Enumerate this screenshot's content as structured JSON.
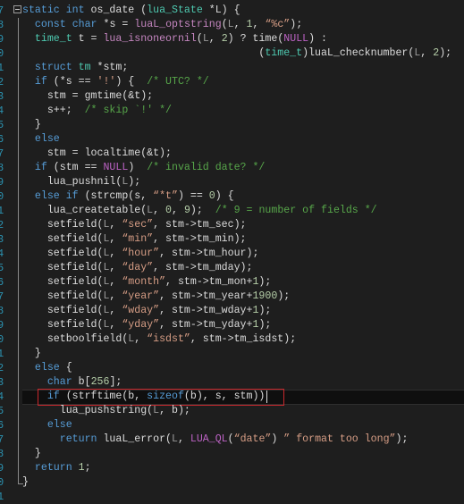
{
  "editor": {
    "colors": {
      "background": "#1e1e1e",
      "keyword": "#569cd6",
      "type": "#4ec9b0",
      "string": "#d69d85",
      "comment": "#57a64a",
      "highlight_box": "#c8282d",
      "line_number": "#2b91af"
    },
    "line_numbers": [
      "7",
      "8",
      "9",
      "0",
      "1",
      "2",
      "3",
      "4",
      "5",
      "6",
      "7",
      "8",
      "9",
      "0",
      "1",
      "2",
      "3",
      "4",
      "5",
      "6",
      "7",
      "8",
      "9",
      "0",
      "1",
      "2",
      "3",
      "4",
      "5",
      "6",
      "7",
      "8",
      "9",
      "0",
      "1"
    ],
    "current_line_index": 28,
    "lines": [
      [
        [
          "kw",
          "static"
        ],
        [
          "pl",
          " "
        ],
        [
          "kw",
          "int"
        ],
        [
          "pl",
          " os_date ("
        ],
        [
          "ty",
          "lua_State"
        ],
        [
          "pl",
          " *L) {"
        ]
      ],
      [
        [
          "pl",
          "  "
        ],
        [
          "kw",
          "const"
        ],
        [
          "pl",
          " "
        ],
        [
          "kw",
          "char"
        ],
        [
          "pl",
          " *s = "
        ],
        [
          "fn",
          "luaL_optstring"
        ],
        [
          "pl",
          "("
        ],
        [
          "id",
          "L"
        ],
        [
          "pl",
          ", "
        ],
        [
          "nu",
          "1"
        ],
        [
          "pl",
          ", "
        ],
        [
          "st",
          "“%c”"
        ],
        [
          "pl",
          ");"
        ]
      ],
      [
        [
          "pl",
          "  "
        ],
        [
          "ty",
          "time_t"
        ],
        [
          "pl",
          " t = "
        ],
        [
          "fn",
          "lua_isnoneornil"
        ],
        [
          "pl",
          "("
        ],
        [
          "id",
          "L"
        ],
        [
          "pl",
          ", "
        ],
        [
          "nu",
          "2"
        ],
        [
          "pl",
          ") ? time("
        ],
        [
          "mc",
          "NULL"
        ],
        [
          "pl",
          ") :"
        ]
      ],
      [
        [
          "pl",
          "                                      ("
        ],
        [
          "ty",
          "time_t"
        ],
        [
          "pl",
          ")luaL_checknumber("
        ],
        [
          "id",
          "L"
        ],
        [
          "pl",
          ", "
        ],
        [
          "nu",
          "2"
        ],
        [
          "pl",
          ");"
        ]
      ],
      [
        [
          "pl",
          "  "
        ],
        [
          "kw",
          "struct"
        ],
        [
          "pl",
          " "
        ],
        [
          "ty",
          "tm"
        ],
        [
          "pl",
          " *stm;"
        ]
      ],
      [
        [
          "pl",
          "  "
        ],
        [
          "kw",
          "if"
        ],
        [
          "pl",
          " (*s == "
        ],
        [
          "st",
          "'!'"
        ],
        [
          "pl",
          ") {  "
        ],
        [
          "cm",
          "/* UTC? */"
        ]
      ],
      [
        [
          "pl",
          "    stm = gmtime(&t);"
        ]
      ],
      [
        [
          "pl",
          "    s++;  "
        ],
        [
          "cm",
          "/* skip `!' */"
        ]
      ],
      [
        [
          "pl",
          "  }"
        ]
      ],
      [
        [
          "pl",
          "  "
        ],
        [
          "kw",
          "else"
        ]
      ],
      [
        [
          "pl",
          "    stm = localtime(&t);"
        ]
      ],
      [
        [
          "pl",
          "  "
        ],
        [
          "kw",
          "if"
        ],
        [
          "pl",
          " (stm == "
        ],
        [
          "mc",
          "NULL"
        ],
        [
          "pl",
          ")  "
        ],
        [
          "cm",
          "/* invalid date? */"
        ]
      ],
      [
        [
          "pl",
          "    lua_pushnil("
        ],
        [
          "id",
          "L"
        ],
        [
          "pl",
          ");"
        ]
      ],
      [
        [
          "pl",
          "  "
        ],
        [
          "kw",
          "else if"
        ],
        [
          "pl",
          " (strcmp(s, "
        ],
        [
          "st",
          "“*t”"
        ],
        [
          "pl",
          ") == "
        ],
        [
          "nu",
          "0"
        ],
        [
          "pl",
          ") {"
        ]
      ],
      [
        [
          "pl",
          "    lua_createtable("
        ],
        [
          "id",
          "L"
        ],
        [
          "pl",
          ", "
        ],
        [
          "nu",
          "0"
        ],
        [
          "pl",
          ", "
        ],
        [
          "nu",
          "9"
        ],
        [
          "pl",
          ");  "
        ],
        [
          "cm",
          "/* 9 = number of fields */"
        ]
      ],
      [
        [
          "pl",
          "    setfield("
        ],
        [
          "id",
          "L"
        ],
        [
          "pl",
          ", "
        ],
        [
          "st",
          "“sec”"
        ],
        [
          "pl",
          ", stm->tm_sec);"
        ]
      ],
      [
        [
          "pl",
          "    setfield("
        ],
        [
          "id",
          "L"
        ],
        [
          "pl",
          ", "
        ],
        [
          "st",
          "“min”"
        ],
        [
          "pl",
          ", stm->tm_min);"
        ]
      ],
      [
        [
          "pl",
          "    setfield("
        ],
        [
          "id",
          "L"
        ],
        [
          "pl",
          ", "
        ],
        [
          "st",
          "“hour”"
        ],
        [
          "pl",
          ", stm->tm_hour);"
        ]
      ],
      [
        [
          "pl",
          "    setfield("
        ],
        [
          "id",
          "L"
        ],
        [
          "pl",
          ", "
        ],
        [
          "st",
          "“day”"
        ],
        [
          "pl",
          ", stm->tm_mday);"
        ]
      ],
      [
        [
          "pl",
          "    setfield("
        ],
        [
          "id",
          "L"
        ],
        [
          "pl",
          ", "
        ],
        [
          "st",
          "“month”"
        ],
        [
          "pl",
          ", stm->tm_mon+"
        ],
        [
          "nu",
          "1"
        ],
        [
          "pl",
          ");"
        ]
      ],
      [
        [
          "pl",
          "    setfield("
        ],
        [
          "id",
          "L"
        ],
        [
          "pl",
          ", "
        ],
        [
          "st",
          "“year”"
        ],
        [
          "pl",
          ", stm->tm_year+"
        ],
        [
          "nu",
          "1900"
        ],
        [
          "pl",
          ");"
        ]
      ],
      [
        [
          "pl",
          "    setfield("
        ],
        [
          "id",
          "L"
        ],
        [
          "pl",
          ", "
        ],
        [
          "st",
          "“wday”"
        ],
        [
          "pl",
          ", stm->tm_wday+"
        ],
        [
          "nu",
          "1"
        ],
        [
          "pl",
          ");"
        ]
      ],
      [
        [
          "pl",
          "    setfield("
        ],
        [
          "id",
          "L"
        ],
        [
          "pl",
          ", "
        ],
        [
          "st",
          "“yday”"
        ],
        [
          "pl",
          ", stm->tm_yday+"
        ],
        [
          "nu",
          "1"
        ],
        [
          "pl",
          ");"
        ]
      ],
      [
        [
          "pl",
          "    setboolfield("
        ],
        [
          "id",
          "L"
        ],
        [
          "pl",
          ", "
        ],
        [
          "st",
          "“isdst”"
        ],
        [
          "pl",
          ", stm->tm_isdst);"
        ]
      ],
      [
        [
          "pl",
          "  }"
        ]
      ],
      [
        [
          "pl",
          "  "
        ],
        [
          "kw",
          "else"
        ],
        [
          "pl",
          " {"
        ]
      ],
      [
        [
          "pl",
          "    "
        ],
        [
          "kw",
          "char"
        ],
        [
          "pl",
          " b["
        ],
        [
          "nu",
          "256"
        ],
        [
          "pl",
          "];"
        ]
      ],
      [
        [
          "pl",
          "    "
        ],
        [
          "kw",
          "if"
        ],
        [
          "pl",
          " (strftime(b, "
        ],
        [
          "kw",
          "sizeof"
        ],
        [
          "pl",
          "(b), s, stm))"
        ]
      ],
      [
        [
          "pl",
          "      lua_pushstring("
        ],
        [
          "id",
          "L"
        ],
        [
          "pl",
          ", b);"
        ]
      ],
      [
        [
          "pl",
          "    "
        ],
        [
          "kw",
          "else"
        ]
      ],
      [
        [
          "pl",
          "      "
        ],
        [
          "kw",
          "return"
        ],
        [
          "pl",
          " luaL_error("
        ],
        [
          "id",
          "L"
        ],
        [
          "pl",
          ", "
        ],
        [
          "mc",
          "LUA_QL"
        ],
        [
          "pl",
          "("
        ],
        [
          "st",
          "“date”"
        ],
        [
          "pl",
          ") "
        ],
        [
          "st",
          "” format too long”"
        ],
        [
          "pl",
          ");"
        ]
      ],
      [
        [
          "pl",
          "  }"
        ]
      ],
      [
        [
          "pl",
          "  "
        ],
        [
          "kw",
          "return"
        ],
        [
          "pl",
          " "
        ],
        [
          "nu",
          "1"
        ],
        [
          "pl",
          ";"
        ]
      ],
      [
        [
          "pl",
          "}"
        ]
      ]
    ]
  }
}
